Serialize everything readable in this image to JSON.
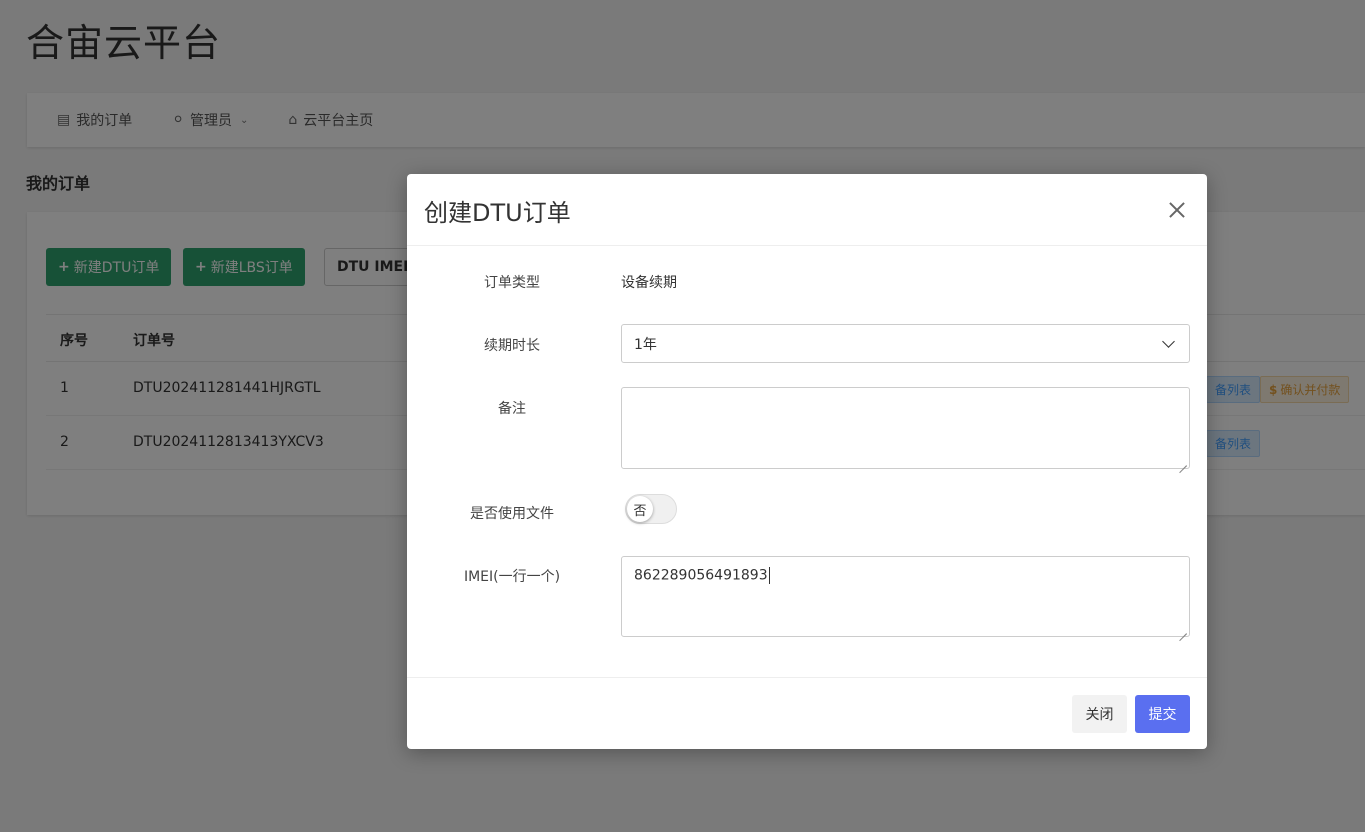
{
  "app": {
    "title": "合宙云平台"
  },
  "nav": {
    "items": [
      {
        "label": "我的订单",
        "icon": "file-invoice-icon"
      },
      {
        "label": "管理员",
        "icon": "user-icon"
      },
      {
        "label": "云平台主页",
        "icon": "home-icon"
      }
    ]
  },
  "page": {
    "section_title": "我的订单",
    "buttons": {
      "new_dtu": "新建DTU订单",
      "new_lbs": "新建LBS订单",
      "dtu_imei": "DTU IMEI"
    },
    "table": {
      "headers": {
        "index": "序号",
        "order_no": "订单号"
      },
      "rows": [
        {
          "index": "1",
          "order_no": "DTU202411281441HJRGTL",
          "tag_list": "备列表",
          "tag_pay": "确认并付款"
        },
        {
          "index": "2",
          "order_no": "DTU2024112813413YXCV3",
          "tag_list": "备列表"
        }
      ]
    }
  },
  "modal": {
    "title": "创建DTU订单",
    "fields": {
      "order_type": {
        "label": "订单类型",
        "value": "设备续期"
      },
      "renew_duration": {
        "label": "续期时长",
        "selected": "1年"
      },
      "remark": {
        "label": "备注",
        "value": ""
      },
      "use_file": {
        "label": "是否使用文件",
        "value": "否"
      },
      "imei": {
        "label": "IMEI(一行一个)",
        "value": "862289056491893"
      }
    },
    "footer": {
      "close_label": "关闭",
      "submit_label": "提交"
    }
  },
  "colors": {
    "accent": "#5a6ff0",
    "green": "#2fa36f"
  }
}
